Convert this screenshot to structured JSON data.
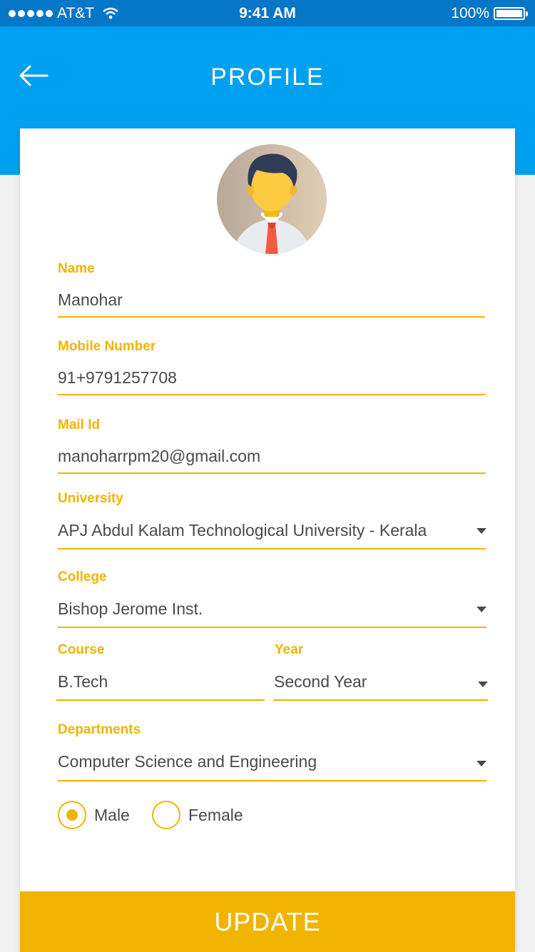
{
  "status_bar": {
    "carrier": "AT&T",
    "time": "9:41 AM",
    "battery": "100%"
  },
  "header": {
    "title": "PROFILE",
    "back_icon": "arrow-left-icon",
    "background": "#00a0f0"
  },
  "form": {
    "name": {
      "label": "Name",
      "value": "Manohar"
    },
    "mobile": {
      "label": "Mobile Number",
      "value": "91+9791257708"
    },
    "mail": {
      "label": "Mail Id",
      "value": "manoharrpm20@gmail.com"
    },
    "university": {
      "label": "University",
      "value": "APJ Abdul Kalam Technological University - Kerala"
    },
    "college": {
      "label": "College",
      "value": "Bishop Jerome Inst."
    },
    "course": {
      "label": "Course",
      "value": "B.Tech"
    },
    "year": {
      "label": "Year",
      "value": "Second Year"
    },
    "department": {
      "label": "Departments",
      "value": "Computer Science and Engineering"
    },
    "gender": {
      "options": [
        "Male",
        "Female"
      ],
      "selected": "Male"
    }
  },
  "update_button": {
    "label": "UPDATE"
  },
  "colors": {
    "accent": "#f0b400",
    "header": "#00a0f0",
    "statusbar": "#0677c8"
  }
}
